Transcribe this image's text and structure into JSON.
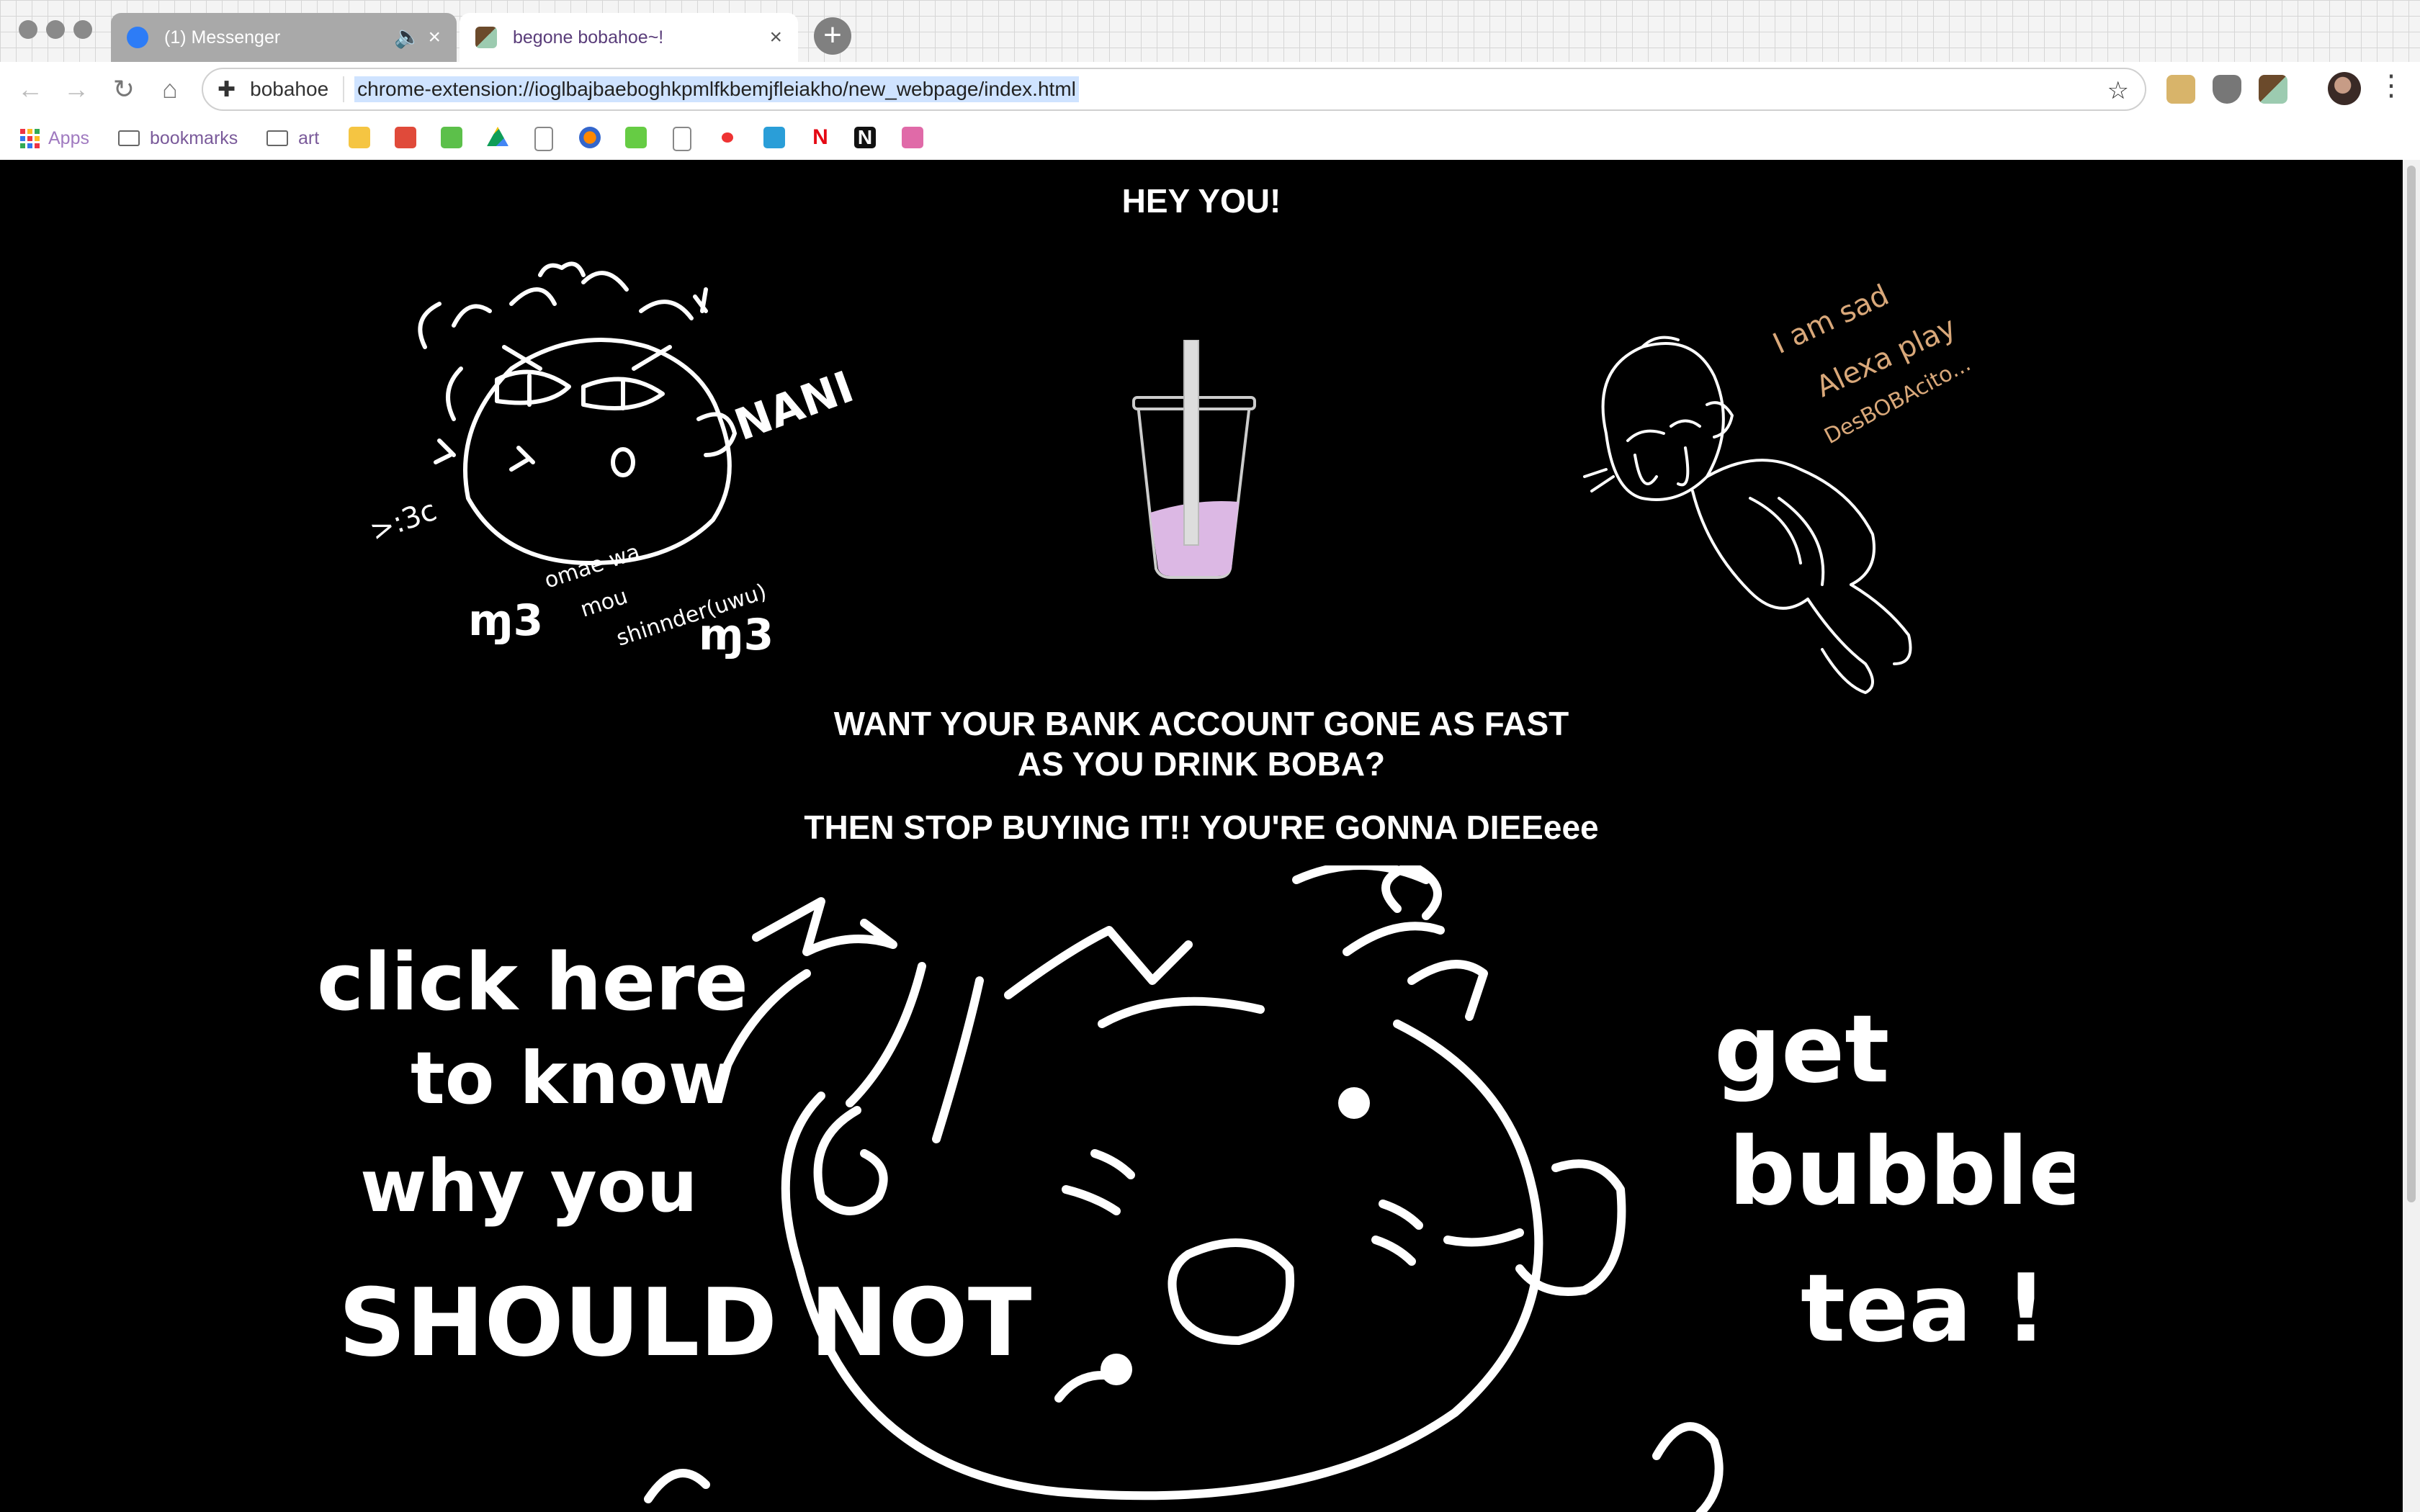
{
  "tabs": [
    {
      "title": "(1) Messenger",
      "active": false,
      "audio_icon": "speaker-icon",
      "favicon": "messenger-icon"
    },
    {
      "title": "begone bobahoe~!",
      "active": true,
      "favicon": "boba-icon"
    }
  ],
  "toolbar": {
    "site_name": "bobahoe",
    "url": "chrome-extension://ioglbajbaeboghkpmlfkbemjfleiakho/new_webpage/index.html"
  },
  "bookmarks": {
    "apps_label": "Apps",
    "folders": [
      {
        "label": "bookmarks"
      },
      {
        "label": "art"
      }
    ]
  },
  "page": {
    "heading": "HEY YOU!",
    "question_line1": "WANT YOUR BANK ACCOUNT GONE AS FAST",
    "question_line2": "AS YOU DRINK BOBA?",
    "warning": "THEN STOP BUYING IT!! YOU'RE GONNA DIEEeee",
    "left_art": {
      "nani": "NANI",
      "face": ">:3c",
      "caption_1": "omae wa",
      "caption_2": "mou",
      "caption_3": "shinnder(uwu)"
    },
    "right_art": {
      "line_1": "I am sad",
      "line_2": "Alexa play",
      "line_3": "DesBOBAcito..."
    },
    "big_art": {
      "left_1": "click here",
      "left_2": "to know",
      "left_3": "why you",
      "left_4": "SHOULD NOT",
      "right_1": "get",
      "right_2": "bubble",
      "right_3": "tea !"
    }
  },
  "colors": {
    "boba_tea": "#dcb8e4",
    "caption_orange": "#d9a87a",
    "active_tab_text": "#5a3d7a"
  }
}
